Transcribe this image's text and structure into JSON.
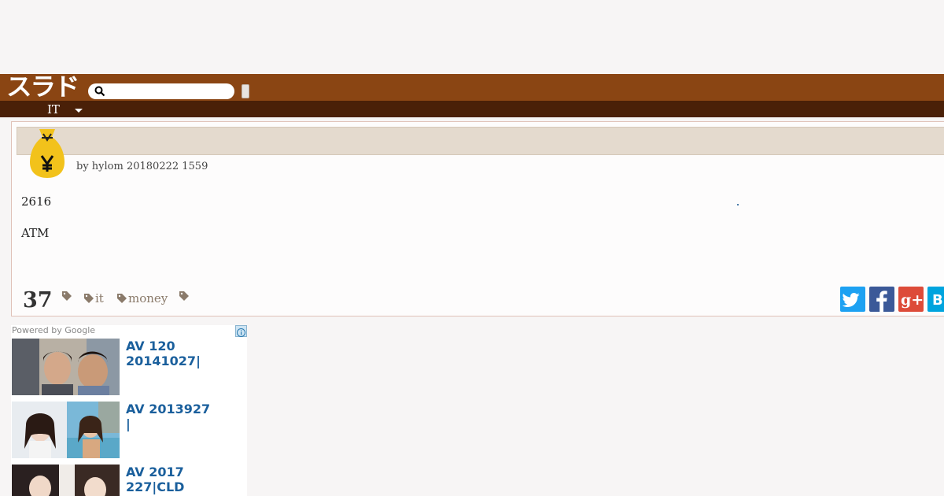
{
  "header": {
    "logo": "スラド",
    "search_placeholder": ""
  },
  "subnav": {
    "section": "IT"
  },
  "article": {
    "byline": "by   hylom 20180222 1559",
    "body_line1": "2616",
    "body_line2": "ATM",
    "comment_count": "37",
    "tags": [
      "",
      "it",
      "money",
      ""
    ],
    "social": [
      "twitter-icon",
      "facebook-icon",
      "google-plus-icon",
      "hatena-icon"
    ]
  },
  "ads": {
    "powered_by": "Powered by Google",
    "items": [
      {
        "title": "AV 120\n20141027|"
      },
      {
        "title": "AV  2013927\n|"
      },
      {
        "title": " AV 2017\n227|CLD"
      }
    ]
  },
  "colors": {
    "header": "#8a4513",
    "subnav": "#4a2008",
    "title_bar": "#e4dace",
    "link": "#1a5f9c"
  }
}
